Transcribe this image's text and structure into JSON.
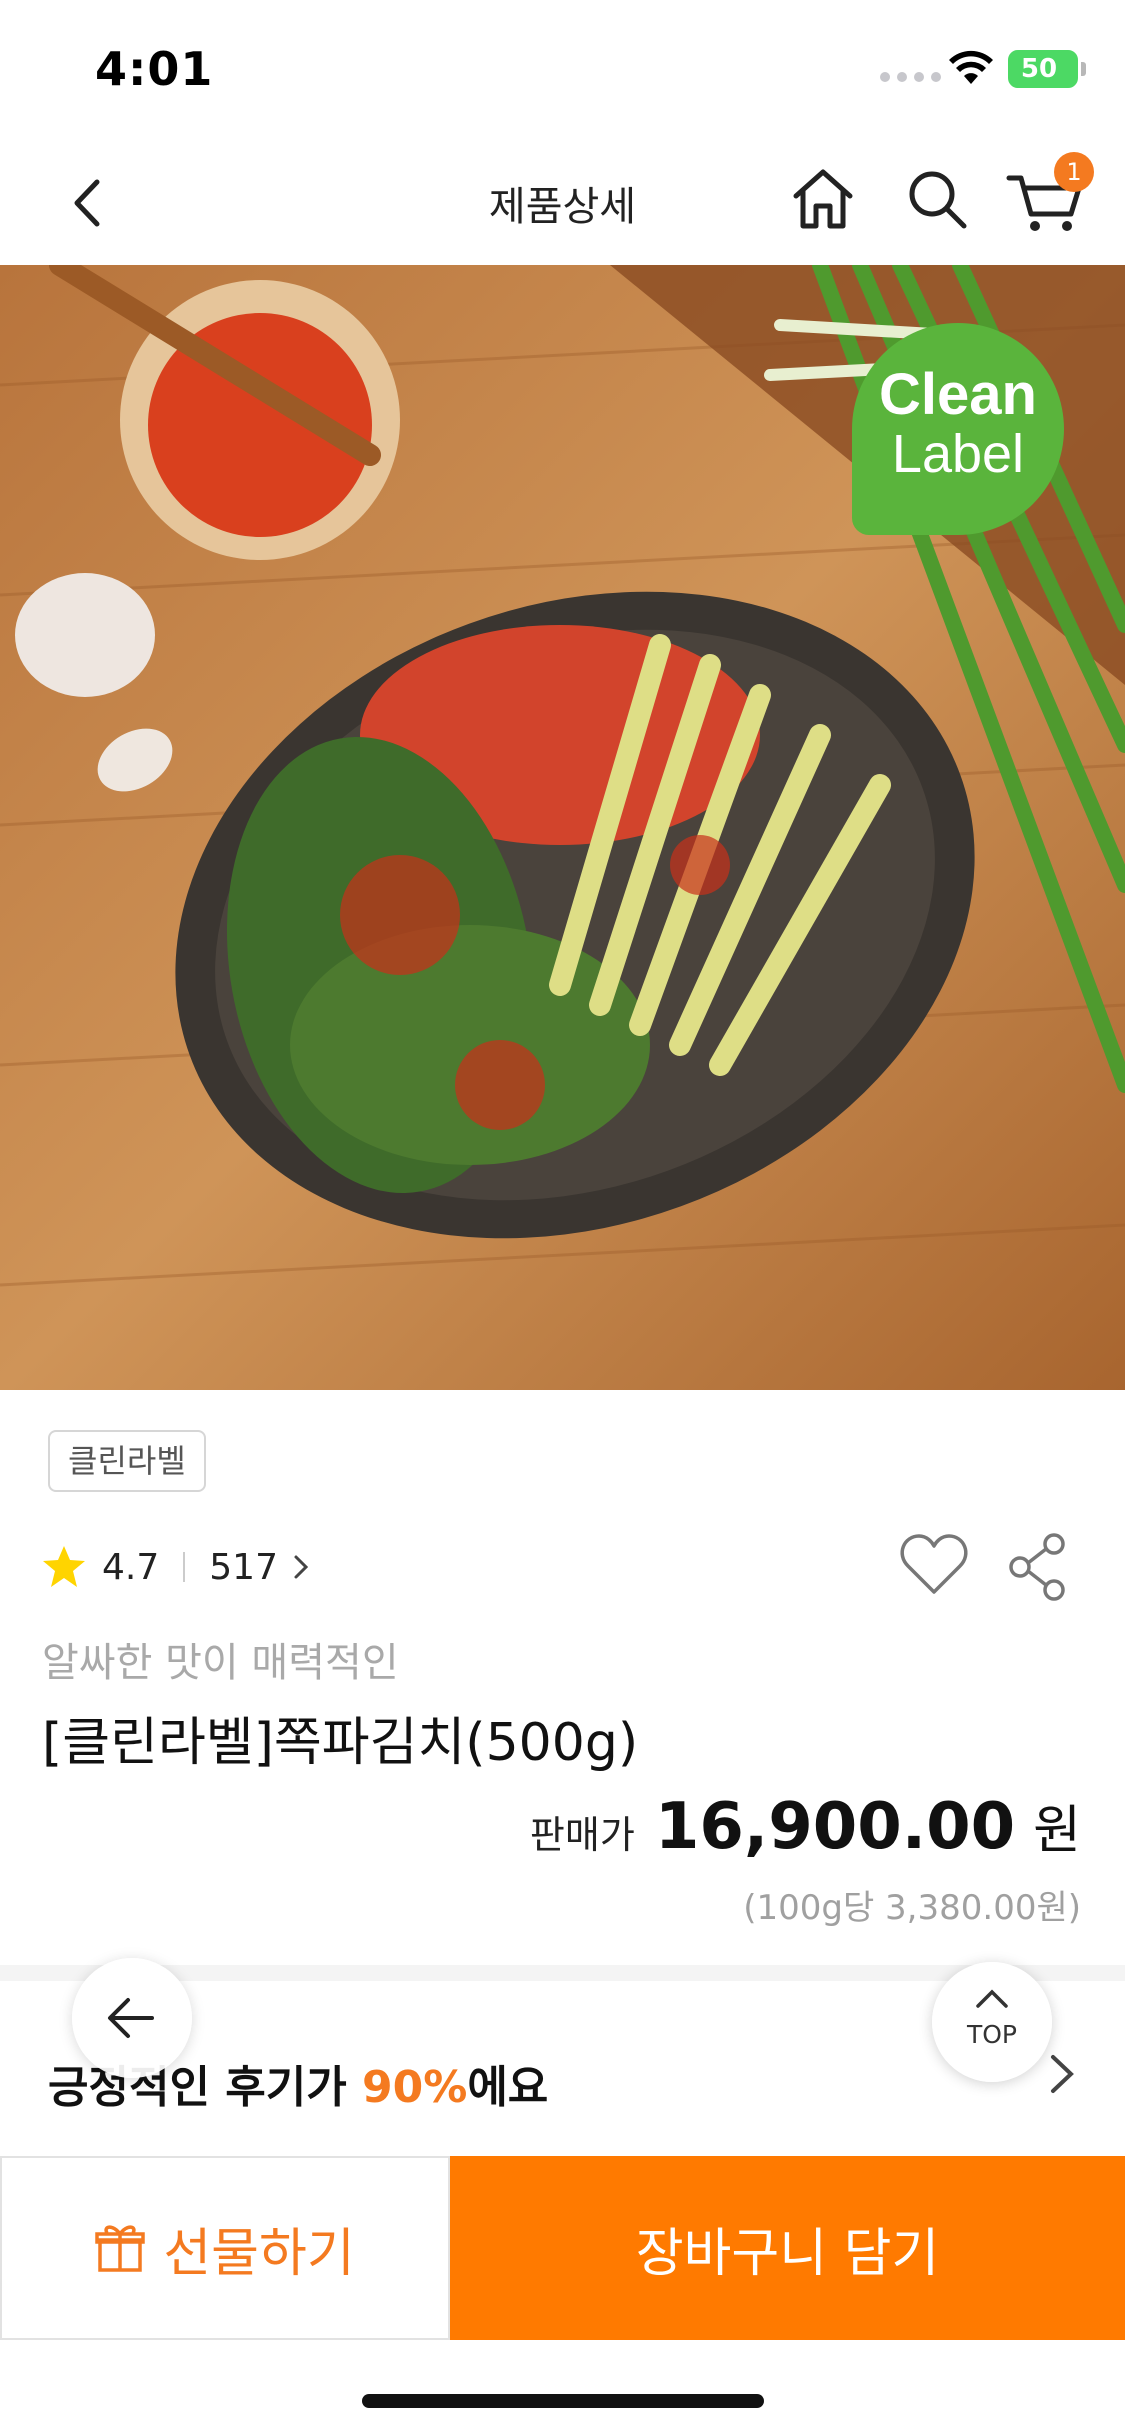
{
  "status_bar": {
    "time": "4:01",
    "battery": "50"
  },
  "nav": {
    "title": "제품상세",
    "cart_count": "1",
    "icons": [
      "back-chevron-icon",
      "home-icon",
      "search-icon",
      "cart-icon"
    ]
  },
  "hero": {
    "description": "kimchi dish photo",
    "badge_line1": "Clean",
    "badge_line2": "Label",
    "badge_color": "#5ab43c"
  },
  "product": {
    "tag": "클린라벨",
    "rating": "4.7",
    "review_count": "517",
    "subtitle": "알싸한 맛이 매력적인",
    "name": "[클린라벨]쪽파김치(500g)",
    "price_label": "판매가",
    "price": "16,900.00",
    "price_unit": "원",
    "unit_price": "(100g당 3,380.00원)"
  },
  "review_banner": {
    "prefix": "긍정적인 후기가 ",
    "highlight": "90%",
    "suffix": "에요"
  },
  "floating": {
    "top_label": "TOP"
  },
  "bottom_bar": {
    "gift_label": "선물하기",
    "cart_label": "장바구니 담기"
  },
  "colors": {
    "accent": "#ff7a00",
    "badge": "#f47a20",
    "star": "#ffd400"
  }
}
